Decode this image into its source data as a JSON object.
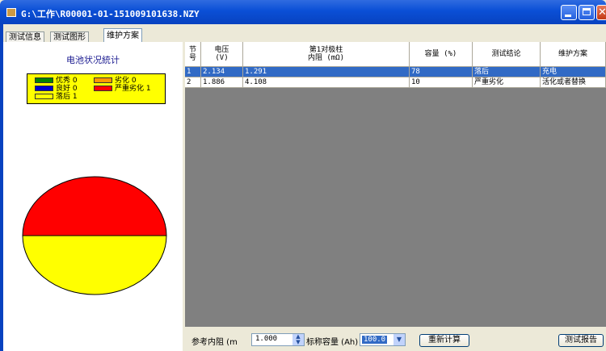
{
  "window": {
    "title": "G:\\工作\\R00001-01-151009101638.NZY"
  },
  "tabs": [
    {
      "label": "测试信息"
    },
    {
      "label": "测试图形"
    },
    {
      "label": "维护方案"
    }
  ],
  "stats": {
    "title": "电池状况統计",
    "legend": [
      {
        "label": "优秀 0",
        "color": "#008000"
      },
      {
        "label": "劣化 0",
        "color": "#ff9900"
      },
      {
        "label": "良好 0",
        "color": "#0000cc"
      },
      {
        "label": "严重劣化 1",
        "color": "#ff0000"
      },
      {
        "label": "落后 1",
        "color": "#ffff00"
      }
    ],
    "pie": [
      {
        "name": "严重劣化",
        "value": 1,
        "color": "#ff0000"
      },
      {
        "name": "落后",
        "value": 1,
        "color": "#ffff00"
      }
    ]
  },
  "table": {
    "headers": [
      "节\n号",
      "电压\n(V)",
      "第1对极柱\n内阻 (mΩ)",
      "容量 (%)",
      "测试结论",
      "维护方案"
    ],
    "rows": [
      [
        "1",
        "2.134",
        "1.291",
        "78",
        "落后",
        "充电"
      ],
      [
        "2",
        "1.886",
        "4.108",
        "10",
        "严重劣化",
        "活化或者替换"
      ]
    ]
  },
  "bottom": {
    "ref_label": "参考内阻 (m",
    "ref_value": "1.000",
    "cap_label": "标称容量 (Ah)",
    "cap_value": "100.0",
    "recalc_label": "重新计算",
    "report_label": "测试报告"
  }
}
